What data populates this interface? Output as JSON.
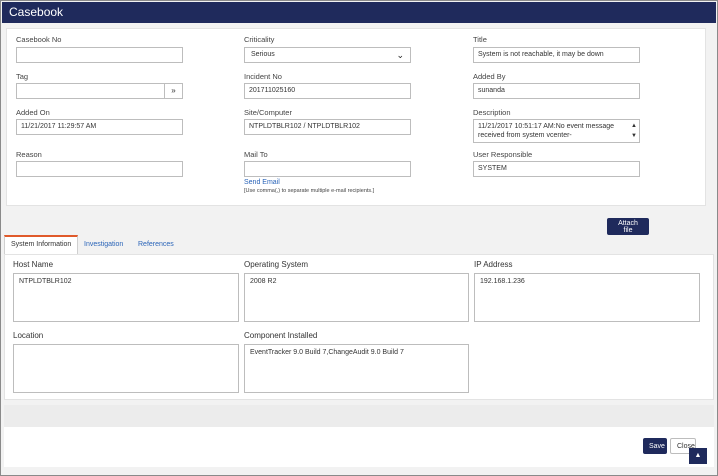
{
  "window": {
    "title": "Casebook"
  },
  "form": {
    "casebook_no": {
      "label": "Casebook No",
      "value": ""
    },
    "criticality": {
      "label": "Criticality",
      "value": "Serious"
    },
    "title": {
      "label": "Title",
      "value": "System is not reachable, it may be down"
    },
    "tag": {
      "label": "Tag",
      "value": ""
    },
    "incident_no": {
      "label": "Incident No",
      "value": "201711025160"
    },
    "added_by": {
      "label": "Added By",
      "value": "sunanda"
    },
    "added_on": {
      "label": "Added On",
      "value": "11/21/2017 11:29:57 AM"
    },
    "site_computer": {
      "label": "Site/Computer",
      "value": "NTPLDTBLR102 / NTPLDTBLR102"
    },
    "description": {
      "label": "Description",
      "value": "11/21/2017 10:51:17 AM:No event message received from system vcenter-"
    },
    "reason": {
      "label": "Reason",
      "value": ""
    },
    "mail_to": {
      "label": "Mail To",
      "value": "",
      "send_email": "Send Email",
      "hint": "[Use comma(,) to separate multiple e-mail recipients.]"
    },
    "user_responsible": {
      "label": "User Responsible",
      "value": "SYSTEM"
    }
  },
  "attach_label": "Attach file",
  "tabs": [
    "System Information",
    "Investigation",
    "References"
  ],
  "system_info": {
    "host_name": {
      "label": "Host Name",
      "value": "NTPLDTBLR102"
    },
    "operating_system": {
      "label": "Operating System",
      "value": "2008 R2"
    },
    "ip_address": {
      "label": "IP Address",
      "value": "192.168.1.236"
    },
    "location": {
      "label": "Location",
      "value": ""
    },
    "component_installed": {
      "label": "Component Installed",
      "value": "EventTracker 9.0 Build 7,ChangeAudit 9.0 Build 7"
    }
  },
  "footer": {
    "save_label": "Save",
    "close_label": "Close"
  },
  "icons": {
    "dropdown": "chevron-down-icon",
    "tag_picker": "double-chevron-down-icon",
    "scroll_top": "arrow-up-icon"
  },
  "colors": {
    "header": "#1f2a5c",
    "active_tab_accent": "#e05a2b",
    "link": "#2a64b8"
  }
}
